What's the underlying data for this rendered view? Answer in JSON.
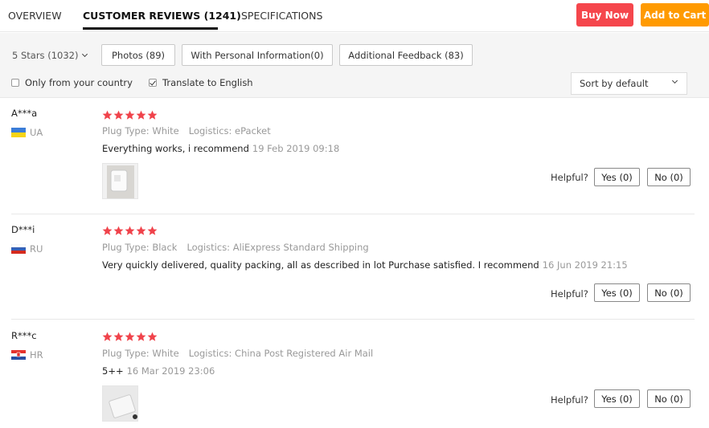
{
  "tabs": [
    {
      "label": "OVERVIEW"
    },
    {
      "label": "CUSTOMER REVIEWS (1241)"
    },
    {
      "label": "SPECIFICATIONS"
    }
  ],
  "actions": {
    "buy_now": "Buy Now",
    "add_to_cart": "Add to Cart"
  },
  "colors": {
    "buy_now": "#f5464c",
    "add_to_cart": "#ff9a00",
    "star": "#f0434b"
  },
  "filters": {
    "star_filter": "5 Stars (1032)",
    "buttons": [
      "Photos (89)",
      "With Personal Information(0)",
      "Additional Feedback (83)"
    ],
    "only_country": {
      "label": "Only from your country",
      "checked": false
    },
    "translate": {
      "label": "Translate to English",
      "checked": true
    },
    "sort": "Sort by default"
  },
  "reviews": [
    {
      "name": "A***a",
      "country": "UA",
      "rating": 5,
      "plug_type": "Plug Type: White",
      "logistics": "Logistics: ePacket",
      "text": "Everything works, i recommend",
      "date": "19 Feb 2019 09:18",
      "has_photo": true,
      "helpful_label": "Helpful?",
      "yes": "Yes (0)",
      "no": "No (0)"
    },
    {
      "name": "D***i",
      "country": "RU",
      "rating": 5,
      "plug_type": "Plug Type: Black",
      "logistics": "Logistics: AliExpress Standard Shipping",
      "text": "Very quickly delivered, quality packing, all as described in lot Purchase satisfied. I recommend",
      "date": "16 Jun 2019 21:15",
      "has_photo": false,
      "helpful_label": "Helpful?",
      "yes": "Yes (0)",
      "no": "No (0)"
    },
    {
      "name": "R***c",
      "country": "HR",
      "rating": 5,
      "plug_type": "Plug Type: White",
      "logistics": "Logistics: China Post Registered Air Mail",
      "text": "5++",
      "date": "16 Mar 2019 23:06",
      "has_photo": true,
      "helpful_label": "Helpful?",
      "yes": "Yes (0)",
      "no": "No (0)"
    }
  ]
}
